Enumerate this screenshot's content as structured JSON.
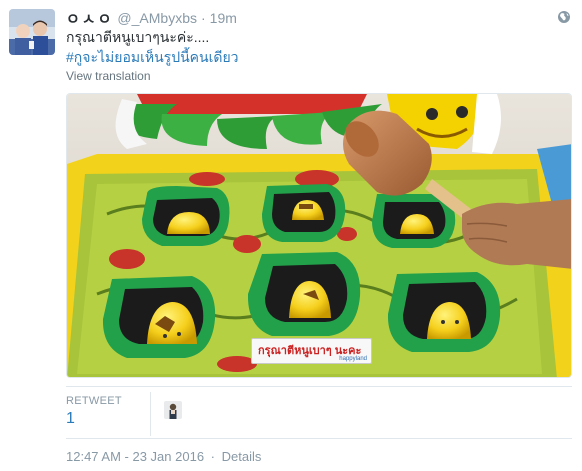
{
  "tweet": {
    "display_name": "ㅇㅅㅇ",
    "screen_name": "@_AMbyxbs",
    "separator": "·",
    "time_ago": "19m",
    "text_line1": "กรุณาตีหนูเบาๆนะค่ะ....",
    "hashtag": "#กูจะไม่ยอมเห็นรูปนี้คนเดียว",
    "translate_link": "View translation"
  },
  "media": {
    "sign_text": "กรุณาตีหนูเบาๆ นะคะ",
    "sign_small": "happyland"
  },
  "stats": {
    "retweet_label": "RETWEET",
    "retweet_count": "1"
  },
  "footer": {
    "timestamp": "12:47 AM - 23 Jan 2016",
    "separator": "·",
    "details_link": "Details"
  }
}
